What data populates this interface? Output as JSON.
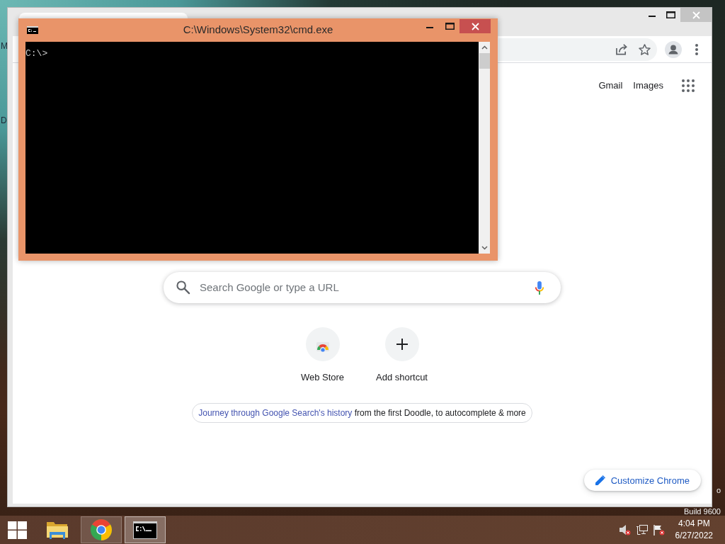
{
  "desktop": {
    "icon_labels": [
      "M",
      "D"
    ],
    "system_info": [
      "o",
      "Build 9600"
    ]
  },
  "browser": {
    "header_links": [
      {
        "label": "Gmail"
      },
      {
        "label": "Images"
      }
    ],
    "search": {
      "placeholder": "Search Google or type a URL"
    },
    "shortcuts": [
      {
        "label": "Web Store",
        "kind": "store"
      },
      {
        "label": "Add shortcut",
        "kind": "add"
      }
    ],
    "promo": {
      "link": "Journey through Google Search's history",
      "text": "from the first Doodle, to autocomplete & more"
    },
    "customize_button": {
      "label": "Customize Chrome"
    }
  },
  "console_window": {
    "title": "C:\\Windows\\System32\\cmd.exe",
    "lines": [
      "C:\\>"
    ]
  },
  "taskbar": {
    "apps": [
      {
        "kind": "folder",
        "running": false,
        "selected": false
      },
      {
        "kind": "browser",
        "running": true,
        "selected": false
      },
      {
        "kind": "console",
        "running": true,
        "selected": true
      }
    ],
    "tray": {
      "volume_muted": true,
      "time": "4:04 PM",
      "date": "6/27/2022"
    }
  }
}
